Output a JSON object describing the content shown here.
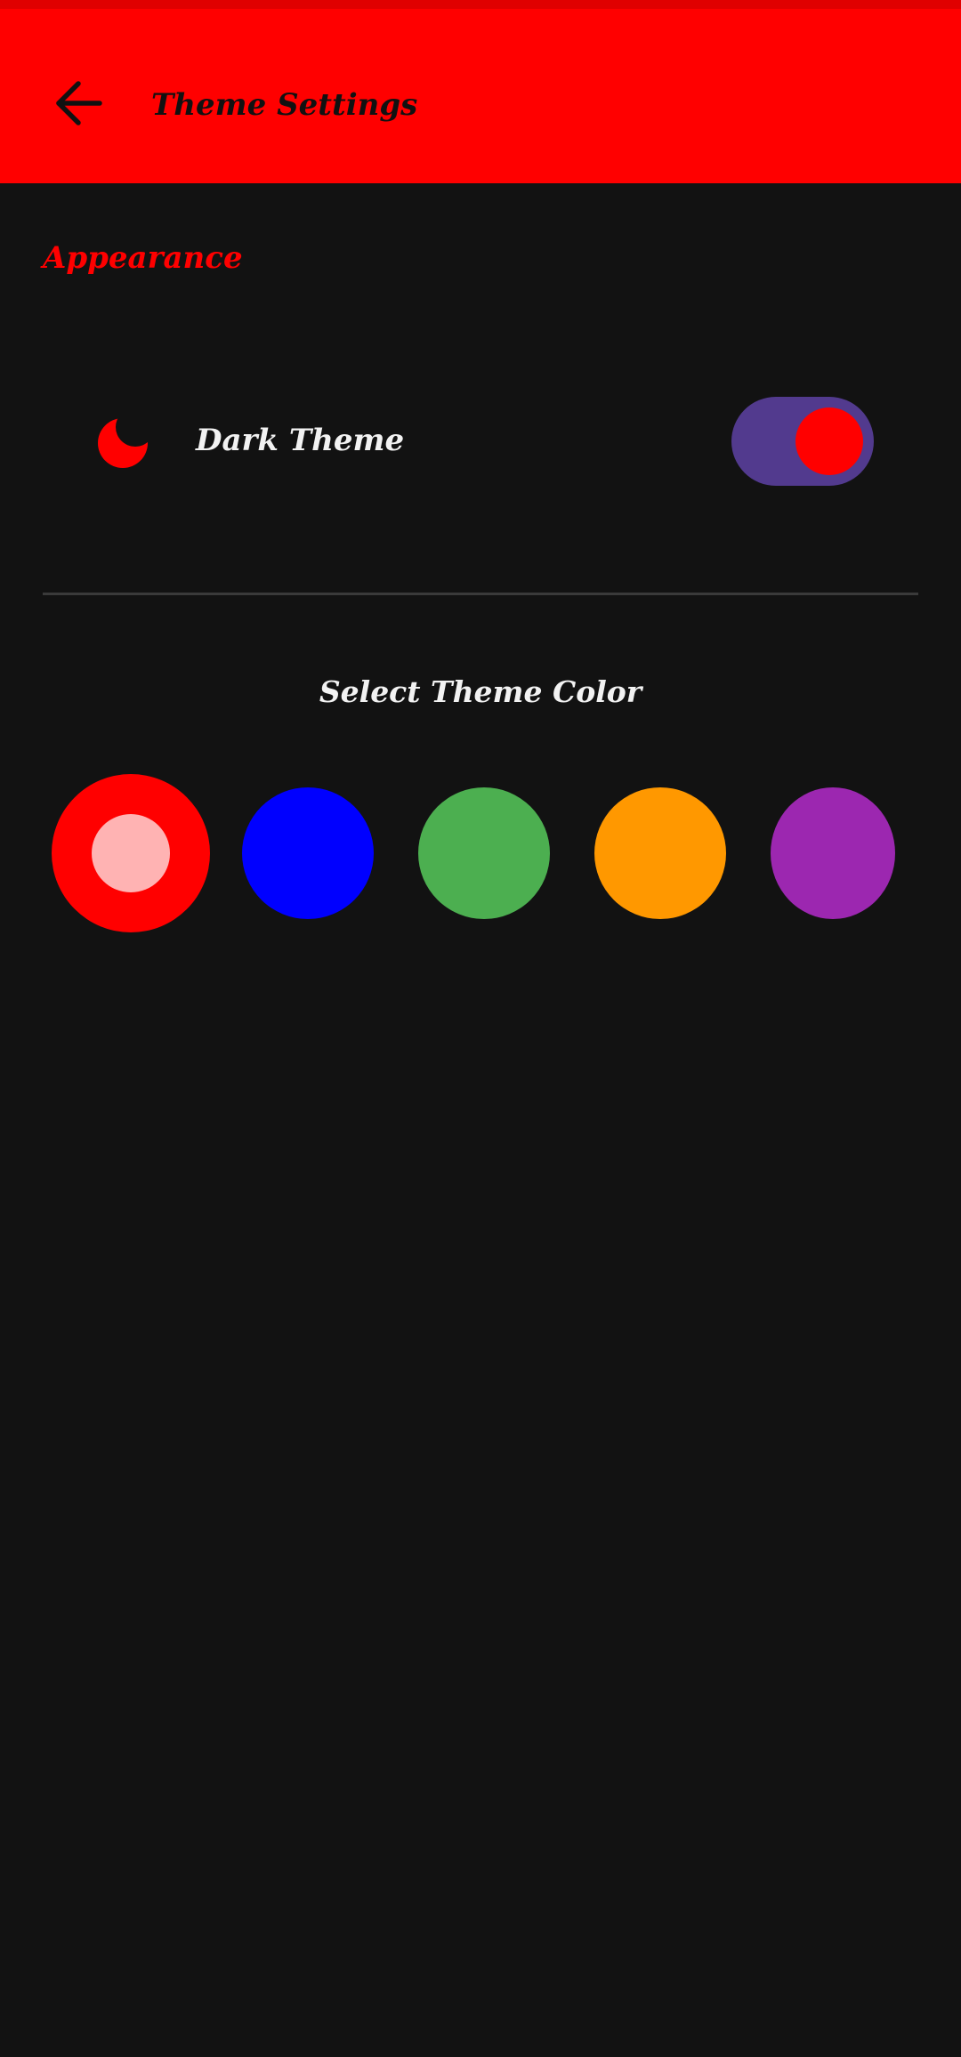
{
  "app_bar": {
    "title": "Theme Settings",
    "back_icon": "arrow-left-icon",
    "background": "#ff0000"
  },
  "appearance": {
    "section_label": "Appearance",
    "accent": "#ff0000",
    "dark_theme": {
      "icon": "moon-icon",
      "label": "Dark Theme",
      "enabled": true,
      "track_color": "#523a8e",
      "knob_color": "#ff0000"
    }
  },
  "theme_color": {
    "title": "Select Theme Color",
    "selected_index": 0,
    "swatches": [
      {
        "color": "#ff0000",
        "inner": "#ffb3b3"
      },
      {
        "color": "#0000ff"
      },
      {
        "color": "#4caf50"
      },
      {
        "color": "#ff9800"
      },
      {
        "color": "#9c27b0"
      }
    ]
  }
}
